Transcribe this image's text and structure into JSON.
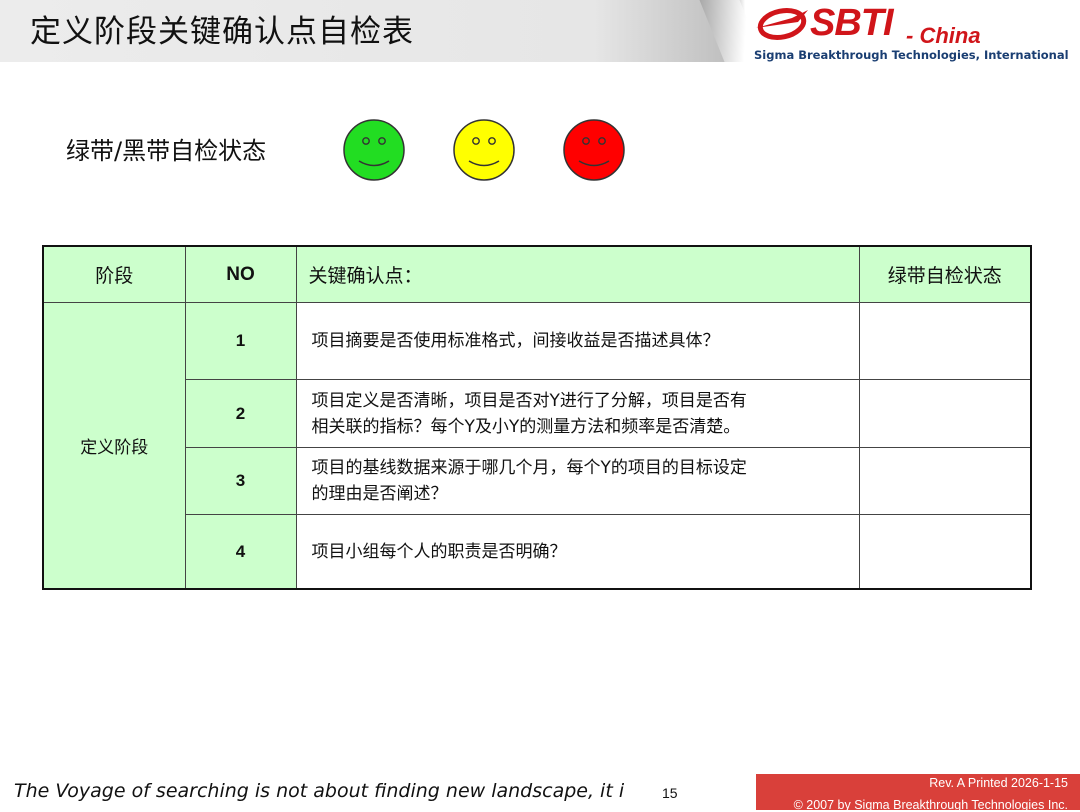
{
  "header": {
    "title": "定义阶段关键确认点自检表",
    "logo": {
      "brand": "SBTI",
      "region": "- China",
      "tagline": "Sigma Breakthrough Technologies, International",
      "color": "#d0151a"
    }
  },
  "status_row": {
    "label": "绿带/黑带自检状态",
    "indicators": [
      {
        "icon": "smiley-green-icon",
        "color": "#22dd22"
      },
      {
        "icon": "smiley-yellow-icon",
        "color": "#ffff00"
      },
      {
        "icon": "smiley-red-icon",
        "color": "#ff0000"
      }
    ]
  },
  "table": {
    "headers": [
      "阶段",
      "NO",
      "关键确认点：",
      "绿带自检状态"
    ],
    "phase": "定义阶段",
    "rows": [
      {
        "no": "1",
        "lines": [
          "项目摘要是否使用标准格式，间接收益是否描述具体？"
        ],
        "status": ""
      },
      {
        "no": "2",
        "lines": [
          "项目定义是否清晰，项目是否对Y进行了分解，项目是否有",
          "相关联的指标？每个Y及小Y的测量方法和频率是否清楚。"
        ],
        "status": ""
      },
      {
        "no": "3",
        "lines": [
          "项目的基线数据来源于哪几个月，每个Y的项目的目标设定",
          "的理由是否阐述？"
        ],
        "status": ""
      },
      {
        "no": "4",
        "lines": [
          "项目小组每个人的职责是否明确？"
        ],
        "status": ""
      }
    ],
    "header_color": "#ccffcc"
  },
  "footer": {
    "quote": "The Voyage of searching is not about finding new landscape, it is",
    "page_number": "15",
    "revision": "Rev. A   Printed 2026-1-15",
    "copyright": "© 2007 by Sigma Breakthrough Technologies Inc.",
    "band_color": "#d9403a"
  }
}
